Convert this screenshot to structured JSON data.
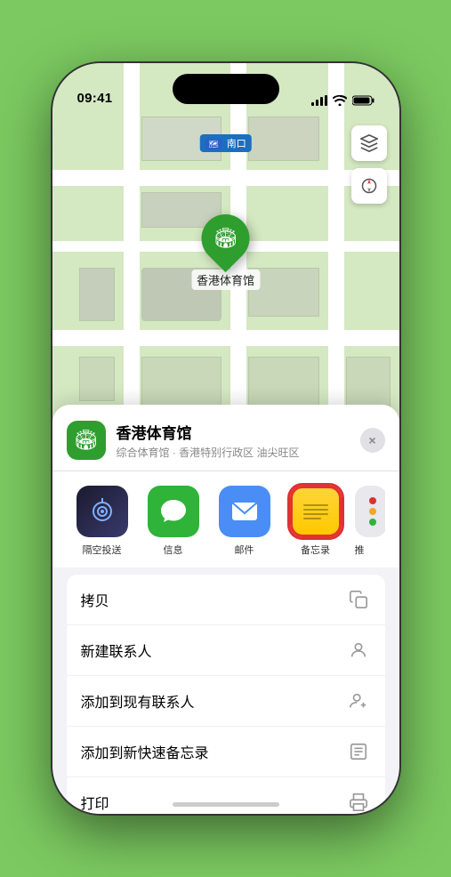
{
  "status": {
    "time": "09:41",
    "location_arrow": "▶"
  },
  "map": {
    "label": "南口",
    "venue_marker": "🏟",
    "venue_name": "香港体育馆",
    "map_layer_icon": "🗺",
    "compass_icon": "◎"
  },
  "sheet": {
    "venue_icon": "🏟",
    "venue_name": "香港体育馆",
    "venue_subtitle": "综合体育馆 · 香港特别行政区 油尖旺区",
    "close_label": "×"
  },
  "share_items": [
    {
      "id": "airdrop",
      "label": "隔空投送",
      "type": "airdrop"
    },
    {
      "id": "messages",
      "label": "信息",
      "type": "messages"
    },
    {
      "id": "mail",
      "label": "邮件",
      "type": "mail"
    },
    {
      "id": "notes",
      "label": "备忘录",
      "type": "notes"
    },
    {
      "id": "more",
      "label": "推",
      "type": "more"
    }
  ],
  "actions": [
    {
      "label": "拷贝",
      "icon": "copy"
    },
    {
      "label": "新建联系人",
      "icon": "person"
    },
    {
      "label": "添加到现有联系人",
      "icon": "person-add"
    },
    {
      "label": "添加到新快速备忘录",
      "icon": "note"
    },
    {
      "label": "打印",
      "icon": "print"
    }
  ]
}
